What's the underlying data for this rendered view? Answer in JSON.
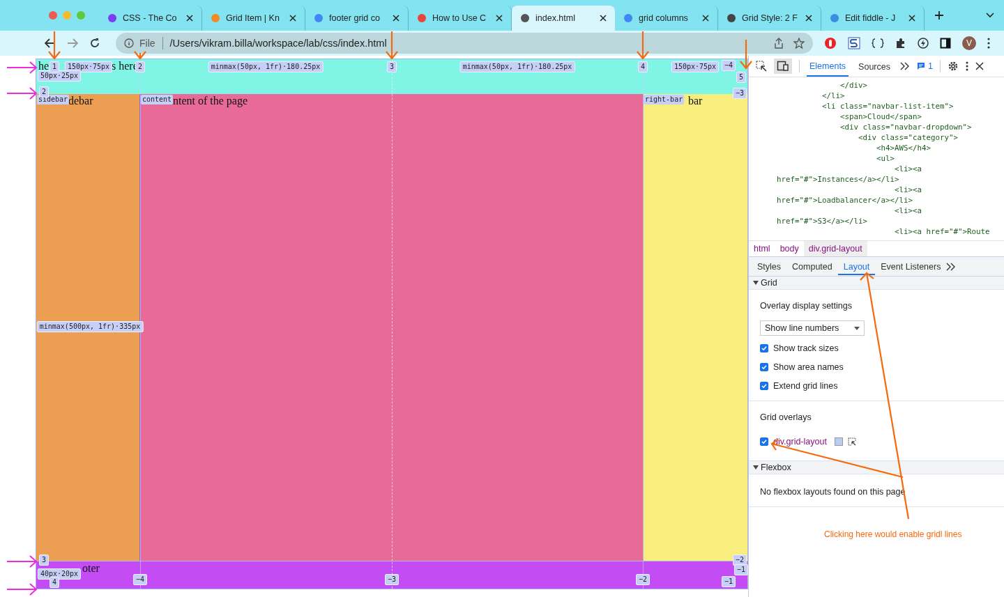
{
  "browser": {
    "tabs": [
      {
        "title": "CSS - The Co",
        "selected": false
      },
      {
        "title": "Grid Item | Kn",
        "selected": false
      },
      {
        "title": "footer grid co",
        "selected": false
      },
      {
        "title": "How to Use C",
        "selected": false
      },
      {
        "title": "index.html",
        "selected": true
      },
      {
        "title": "grid columns",
        "selected": false
      },
      {
        "title": "Grid Style: 2 F",
        "selected": false
      },
      {
        "title": "Edit fiddle - J",
        "selected": false
      }
    ],
    "address": {
      "scheme": "File",
      "url": "/Users/vikram.billa/workspace/lab/css/index.html"
    },
    "profile": "V"
  },
  "page": {
    "header_text": [
      "he",
      "s here"
    ],
    "sidebar_text": "debar",
    "content_text": "ntent of the page",
    "right_bar_text": "bar",
    "footer_text": "oter"
  },
  "overlay_labels": [
    {
      "text": "1",
      "kind": "line"
    },
    {
      "text": "150px·75px",
      "kind": "track"
    },
    {
      "text": "2",
      "kind": "line"
    },
    {
      "text": "minmax(50px, 1fr)·180.25px",
      "kind": "track"
    },
    {
      "text": "3",
      "kind": "line"
    },
    {
      "text": "minmax(50px, 1fr)·180.25px",
      "kind": "track"
    },
    {
      "text": "4",
      "kind": "line"
    },
    {
      "text": "150px·75px",
      "kind": "track"
    },
    {
      "text": "−4",
      "kind": "line"
    },
    {
      "text": "5",
      "kind": "line"
    },
    {
      "text": "50px·25px",
      "kind": "track"
    },
    {
      "text": "2",
      "kind": "line"
    },
    {
      "text": "sidebar",
      "kind": "area"
    },
    {
      "text": "content",
      "kind": "area"
    },
    {
      "text": "right-bar",
      "kind": "area"
    },
    {
      "text": "−3",
      "kind": "line"
    },
    {
      "text": "minmax(500px, 1fr)·335px",
      "kind": "track"
    },
    {
      "text": "3",
      "kind": "line"
    },
    {
      "text": "−2",
      "kind": "line"
    },
    {
      "text": "−1",
      "kind": "line"
    },
    {
      "text": "40px·20px",
      "kind": "track"
    },
    {
      "text": "4",
      "kind": "line"
    },
    {
      "text": "−4",
      "kind": "line"
    },
    {
      "text": "−3",
      "kind": "line"
    },
    {
      "text": "−2",
      "kind": "line"
    },
    {
      "text": "−1",
      "kind": "line"
    }
  ],
  "devtools": {
    "tabs": [
      {
        "label": "Elements",
        "selected": true
      },
      {
        "label": "Sources",
        "selected": false
      }
    ],
    "issues": "1",
    "code_lines": [
      "              </div>",
      "          </li>",
      "          <li class=\"navbar-list-item\">",
      "              <span>Cloud</span>",
      "              <div class=\"navbar-dropdown\">",
      "                  <div class=\"category\">",
      "                      <h4>AWS</h4>",
      "                      <ul>",
      "                          <li><a",
      "href=\"#\">Instances</a></li>",
      "                          <li><a",
      "href=\"#\">Loadbalancer</a></li>",
      "                          <li><a",
      "href=\"#\">S3</a></li>",
      "                          <li><a href=\"#\">Route"
    ],
    "breadcrumbs": [
      {
        "label": "html",
        "selected": false
      },
      {
        "label": "body",
        "selected": false
      },
      {
        "label": "div.grid-layout",
        "selected": true
      }
    ],
    "panel_tabs": [
      {
        "label": "Styles",
        "selected": false
      },
      {
        "label": "Computed",
        "selected": false
      },
      {
        "label": "Layout",
        "selected": true
      },
      {
        "label": "Event Listeners",
        "selected": false
      }
    ],
    "grid": {
      "title": "Grid",
      "expanded": true,
      "overlay_settings_title": "Overlay display settings",
      "select": "Show line numbers",
      "options": [
        {
          "label": "Show track sizes",
          "checked": true
        },
        {
          "label": "Show area names",
          "checked": true
        },
        {
          "label": "Extend grid lines",
          "checked": true
        }
      ],
      "overlays_title": "Grid overlays",
      "overlays": [
        {
          "label": "div.grid-layout",
          "checked": true,
          "color": "#bccbf3"
        }
      ]
    },
    "flexbox": {
      "title": "Flexbox",
      "expanded": true,
      "message": "No flexbox layouts found on this page"
    }
  },
  "annotation": "Clicking here would enable gridl lines"
}
